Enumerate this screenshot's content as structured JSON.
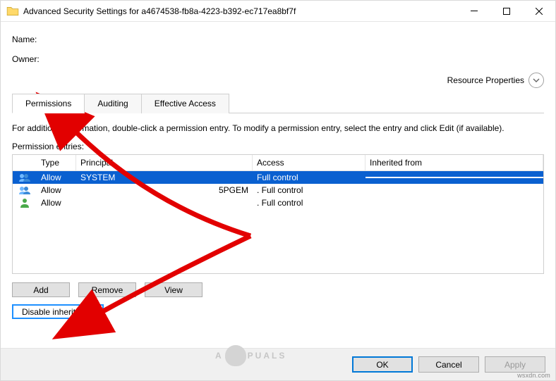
{
  "window": {
    "title": "Advanced Security Settings for a4674538-fb8a-4223-b392-ec717ea8bf7f"
  },
  "fields": {
    "name_label": "Name:",
    "name_value": "",
    "owner_label": "Owner:",
    "owner_value": ""
  },
  "resource_properties_label": "Resource Properties",
  "tabs": {
    "permissions": "Permissions",
    "auditing": "Auditing",
    "effective": "Effective Access"
  },
  "info_text": "For additional information, double-click a permission entry. To modify a permission entry, select the entry and click Edit (if available).",
  "entries_label": "Permission entries:",
  "columns": {
    "type": "Type",
    "principal": "Principal",
    "access": "Access",
    "inherited": "Inherited from"
  },
  "rows": [
    {
      "type": "Allow",
      "principal": "SYSTEM",
      "access": "Full control",
      "inherited": "",
      "selected": true,
      "icon": "group"
    },
    {
      "type": "Allow",
      "principal": "5PGEM",
      "access": "Full control",
      "inherited": "",
      "selected": false,
      "icon": "group"
    },
    {
      "type": "Allow",
      "principal": "",
      "access": "Full control",
      "inherited": "",
      "selected": false,
      "icon": "user"
    }
  ],
  "buttons": {
    "add": "Add",
    "remove": "Remove",
    "view": "View",
    "disable_inheritance": "Disable inheritance"
  },
  "footer": {
    "ok": "OK",
    "cancel": "Cancel",
    "apply": "Apply"
  },
  "watermark": "wsxdn.com",
  "logo_text_left": "A",
  "logo_text_right": "PUALS"
}
